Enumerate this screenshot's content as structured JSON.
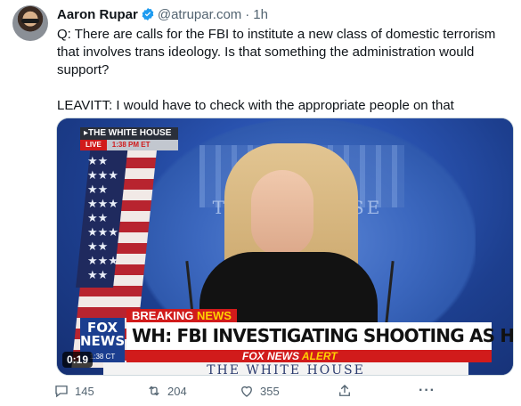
{
  "author": {
    "name": "Aaron Rupar",
    "handle": "@atrupar.com",
    "separator": "·",
    "time": "1h"
  },
  "tweet": {
    "paragraph_1": "Q: There are calls for the FBI to institute a new class of domestic terrorism that involves trans ideology. Is that something the administration would support?",
    "paragraph_2": "LEAVITT: I would have to check with the appropriate people on that"
  },
  "video": {
    "location_label": "THE WHITE HOUSE",
    "live_label": "LIVE",
    "live_time": "1:38 PM ET",
    "seal_text": "THE WH    OUSE",
    "seal_subtext": "W",
    "network_logo": "FOX NEWS",
    "clock": "1:38 CT",
    "breaking_prefix": "BREAKING",
    "breaking_suffix": "NEWS",
    "headline": "WH: FBI INVESTIGATING SHOOTING AS HATE CRIME",
    "alert_prefix": "FOX NEWS",
    "alert_suffix": "ALERT",
    "ticker": "THE WHITE HOUSE",
    "duration": "0:19"
  },
  "actions": {
    "replies": "145",
    "reposts": "204",
    "likes": "355",
    "more": "···"
  },
  "colors": {
    "verified": "#1d9bf0",
    "muted": "#536471",
    "fox_red": "#d11b1b",
    "fox_blue": "#1b3e8f"
  },
  "icons": {
    "reply": "reply-icon",
    "repost": "repost-icon",
    "like": "heart-icon",
    "share": "share-icon",
    "more": "more-icon",
    "verified": "verified-badge-icon"
  }
}
